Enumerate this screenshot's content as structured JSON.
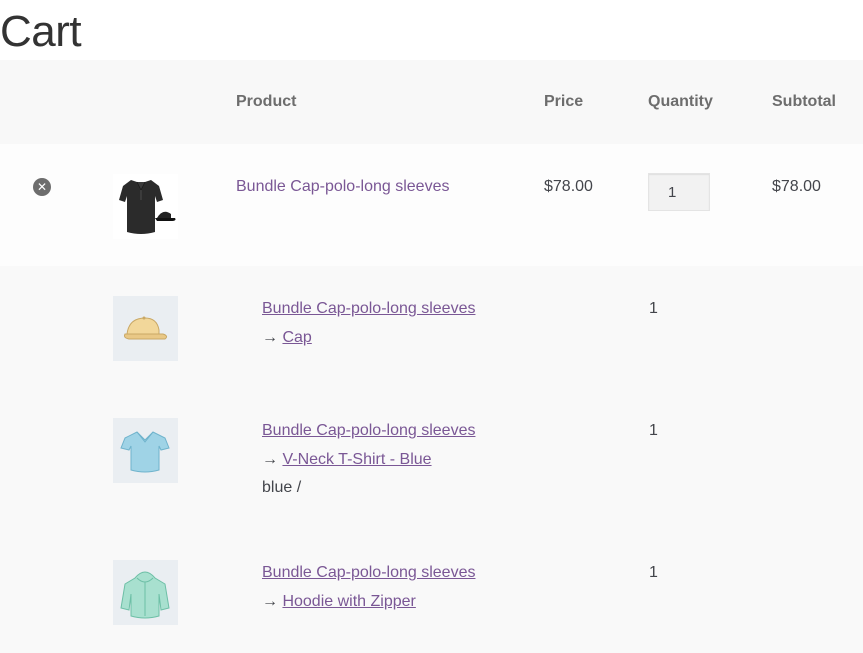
{
  "page": {
    "title": "Cart"
  },
  "table": {
    "headers": {
      "product": "Product",
      "price": "Price",
      "quantity": "Quantity",
      "subtotal": "Subtotal"
    }
  },
  "main_item": {
    "remove_icon": "close-circle-icon",
    "name": "Bundle Cap-polo-long sleeves",
    "price": "$78.00",
    "quantity": "1",
    "subtotal": "$78.00"
  },
  "bundled_items": [
    {
      "parent": "Bundle Cap-polo-long sleeves",
      "arrow": "→",
      "name": "Cap",
      "variation": "",
      "quantity": "1",
      "icon": "cap-icon"
    },
    {
      "parent": "Bundle Cap-polo-long sleeves",
      "arrow": "→",
      "name": "V-Neck T-Shirt - Blue",
      "variation": "blue /",
      "quantity": "1",
      "icon": "tshirt-icon"
    },
    {
      "parent": "Bundle Cap-polo-long sleeves",
      "arrow": "→",
      "name": "Hoodie with Zipper",
      "variation": "",
      "quantity": "1",
      "icon": "hoodie-icon"
    }
  ],
  "colors": {
    "link": "#7a5795",
    "header_bg": "#f8f8f8",
    "text": "#43454b"
  }
}
